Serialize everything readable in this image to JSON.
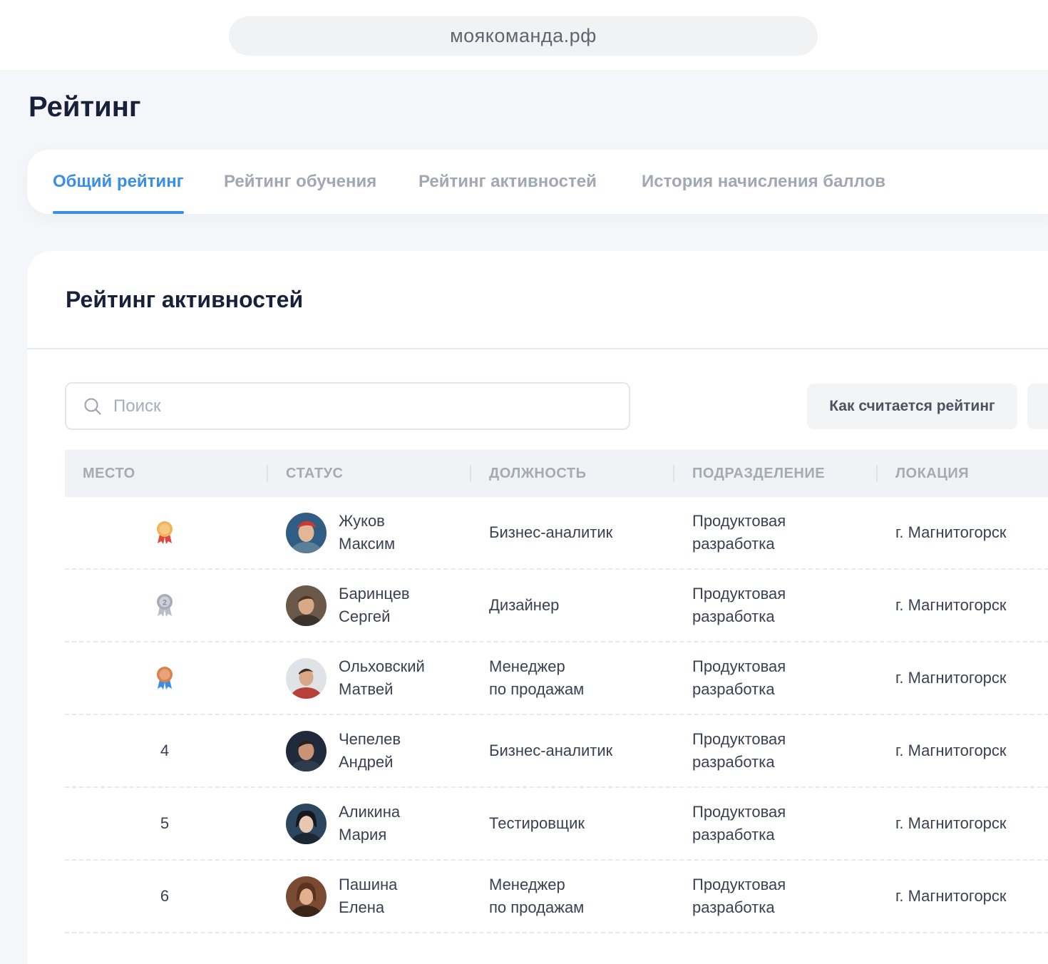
{
  "browser": {
    "address": "моякоманда.рф"
  },
  "page": {
    "title": "Рейтинг"
  },
  "tabs": [
    {
      "label": "Общий рейтинг",
      "active": true
    },
    {
      "label": "Рейтинг обучения",
      "active": false
    },
    {
      "label": "Рейтинг активностей",
      "active": false
    },
    {
      "label": "История начисления баллов",
      "active": false
    }
  ],
  "section": {
    "title": "Рейтинг активностей"
  },
  "search": {
    "placeholder": "Поиск",
    "value": ""
  },
  "actions": {
    "how_label": "Как считается рейтинг"
  },
  "table": {
    "columns": [
      "МЕСТО",
      "СТАТУС",
      "ДОЛЖНОСТЬ",
      "ПОДРАЗДЕЛЕНИЕ",
      "ЛОКАЦИЯ"
    ],
    "rows": [
      {
        "place": "",
        "medal": "gold-medal-icon",
        "last_name": "Жуков",
        "first_name": "Максим",
        "position_line1": "Бизнес-аналитик",
        "position_line2": "",
        "dept_line1": "Продуктовая",
        "dept_line2": "разработка",
        "location": "г. Магнитогорск"
      },
      {
        "place": "",
        "medal": "silver-medal-icon",
        "last_name": "Баринцев",
        "first_name": "Сергей",
        "position_line1": "Дизайнер",
        "position_line2": "",
        "dept_line1": "Продуктовая",
        "dept_line2": "разработка",
        "location": "г. Магнитогорск"
      },
      {
        "place": "",
        "medal": "bronze-medal-icon",
        "last_name": "Ольховский",
        "first_name": "Матвей",
        "position_line1": "Менеджер",
        "position_line2": "по продажам",
        "dept_line1": "Продуктовая",
        "dept_line2": "разработка",
        "location": "г. Магнитогорск"
      },
      {
        "place": "4",
        "medal": "",
        "last_name": "Чепелев",
        "first_name": "Андрей",
        "position_line1": "Бизнес-аналитик",
        "position_line2": "",
        "dept_line1": "Продуктовая",
        "dept_line2": "разработка",
        "location": "г. Магнитогорск"
      },
      {
        "place": "5",
        "medal": "",
        "last_name": "Аликина",
        "first_name": "Мария",
        "position_line1": "Тестировщик",
        "position_line2": "",
        "dept_line1": "Продуктовая",
        "dept_line2": "разработка",
        "location": "г. Магнитогорск"
      },
      {
        "place": "6",
        "medal": "",
        "last_name": "Пашина",
        "first_name": "Елена",
        "position_line1": "Менеджер",
        "position_line2": "по продажам",
        "dept_line1": "Продуктовая",
        "dept_line2": "разработка",
        "location": "г. Магнитогорск"
      }
    ]
  },
  "colors": {
    "accent": "#3a8ee6",
    "title": "#17213a",
    "muted": "#a2a8b3",
    "gold": "#f0b35c",
    "silver": "#b9bec7",
    "bronze": "#d9824e",
    "ribbon_red": "#e0473f",
    "ribbon_blue": "#3a8ee6"
  }
}
